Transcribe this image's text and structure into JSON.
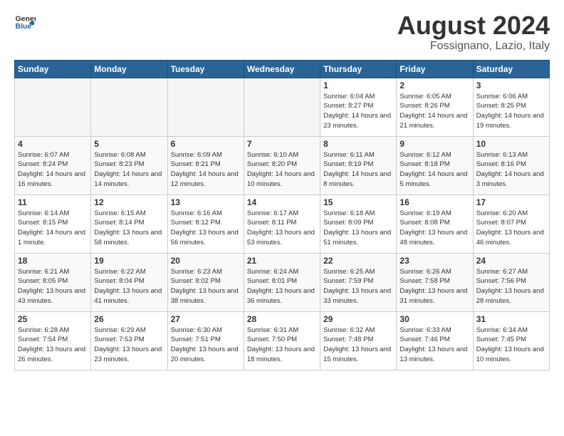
{
  "header": {
    "logo_general": "General",
    "logo_blue": "Blue",
    "month_title": "August 2024",
    "location": "Fossignano, Lazio, Italy"
  },
  "weekdays": [
    "Sunday",
    "Monday",
    "Tuesday",
    "Wednesday",
    "Thursday",
    "Friday",
    "Saturday"
  ],
  "weeks": [
    [
      {
        "day": "",
        "empty": true
      },
      {
        "day": "",
        "empty": true
      },
      {
        "day": "",
        "empty": true
      },
      {
        "day": "",
        "empty": true
      },
      {
        "day": "1",
        "sunrise": "6:04 AM",
        "sunset": "8:27 PM",
        "daylight": "14 hours and 23 minutes."
      },
      {
        "day": "2",
        "sunrise": "6:05 AM",
        "sunset": "8:26 PM",
        "daylight": "14 hours and 21 minutes."
      },
      {
        "day": "3",
        "sunrise": "6:06 AM",
        "sunset": "8:25 PM",
        "daylight": "14 hours and 19 minutes."
      }
    ],
    [
      {
        "day": "4",
        "sunrise": "6:07 AM",
        "sunset": "8:24 PM",
        "daylight": "14 hours and 16 minutes."
      },
      {
        "day": "5",
        "sunrise": "6:08 AM",
        "sunset": "8:23 PM",
        "daylight": "14 hours and 14 minutes."
      },
      {
        "day": "6",
        "sunrise": "6:09 AM",
        "sunset": "8:21 PM",
        "daylight": "14 hours and 12 minutes."
      },
      {
        "day": "7",
        "sunrise": "6:10 AM",
        "sunset": "8:20 PM",
        "daylight": "14 hours and 10 minutes."
      },
      {
        "day": "8",
        "sunrise": "6:11 AM",
        "sunset": "8:19 PM",
        "daylight": "14 hours and 8 minutes."
      },
      {
        "day": "9",
        "sunrise": "6:12 AM",
        "sunset": "8:18 PM",
        "daylight": "14 hours and 5 minutes."
      },
      {
        "day": "10",
        "sunrise": "6:13 AM",
        "sunset": "8:16 PM",
        "daylight": "14 hours and 3 minutes."
      }
    ],
    [
      {
        "day": "11",
        "sunrise": "6:14 AM",
        "sunset": "8:15 PM",
        "daylight": "14 hours and 1 minute."
      },
      {
        "day": "12",
        "sunrise": "6:15 AM",
        "sunset": "8:14 PM",
        "daylight": "13 hours and 58 minutes."
      },
      {
        "day": "13",
        "sunrise": "6:16 AM",
        "sunset": "8:12 PM",
        "daylight": "13 hours and 56 minutes."
      },
      {
        "day": "14",
        "sunrise": "6:17 AM",
        "sunset": "8:11 PM",
        "daylight": "13 hours and 53 minutes."
      },
      {
        "day": "15",
        "sunrise": "6:18 AM",
        "sunset": "8:09 PM",
        "daylight": "13 hours and 51 minutes."
      },
      {
        "day": "16",
        "sunrise": "6:19 AM",
        "sunset": "8:08 PM",
        "daylight": "13 hours and 48 minutes."
      },
      {
        "day": "17",
        "sunrise": "6:20 AM",
        "sunset": "8:07 PM",
        "daylight": "13 hours and 46 minutes."
      }
    ],
    [
      {
        "day": "18",
        "sunrise": "6:21 AM",
        "sunset": "8:05 PM",
        "daylight": "13 hours and 43 minutes."
      },
      {
        "day": "19",
        "sunrise": "6:22 AM",
        "sunset": "8:04 PM",
        "daylight": "13 hours and 41 minutes."
      },
      {
        "day": "20",
        "sunrise": "6:23 AM",
        "sunset": "8:02 PM",
        "daylight": "13 hours and 38 minutes."
      },
      {
        "day": "21",
        "sunrise": "6:24 AM",
        "sunset": "8:01 PM",
        "daylight": "13 hours and 36 minutes."
      },
      {
        "day": "22",
        "sunrise": "6:25 AM",
        "sunset": "7:59 PM",
        "daylight": "13 hours and 33 minutes."
      },
      {
        "day": "23",
        "sunrise": "6:26 AM",
        "sunset": "7:58 PM",
        "daylight": "13 hours and 31 minutes."
      },
      {
        "day": "24",
        "sunrise": "6:27 AM",
        "sunset": "7:56 PM",
        "daylight": "13 hours and 28 minutes."
      }
    ],
    [
      {
        "day": "25",
        "sunrise": "6:28 AM",
        "sunset": "7:54 PM",
        "daylight": "13 hours and 26 minutes."
      },
      {
        "day": "26",
        "sunrise": "6:29 AM",
        "sunset": "7:53 PM",
        "daylight": "13 hours and 23 minutes."
      },
      {
        "day": "27",
        "sunrise": "6:30 AM",
        "sunset": "7:51 PM",
        "daylight": "13 hours and 20 minutes."
      },
      {
        "day": "28",
        "sunrise": "6:31 AM",
        "sunset": "7:50 PM",
        "daylight": "13 hours and 18 minutes."
      },
      {
        "day": "29",
        "sunrise": "6:32 AM",
        "sunset": "7:48 PM",
        "daylight": "13 hours and 15 minutes."
      },
      {
        "day": "30",
        "sunrise": "6:33 AM",
        "sunset": "7:46 PM",
        "daylight": "13 hours and 13 minutes."
      },
      {
        "day": "31",
        "sunrise": "6:34 AM",
        "sunset": "7:45 PM",
        "daylight": "13 hours and 10 minutes."
      }
    ]
  ]
}
